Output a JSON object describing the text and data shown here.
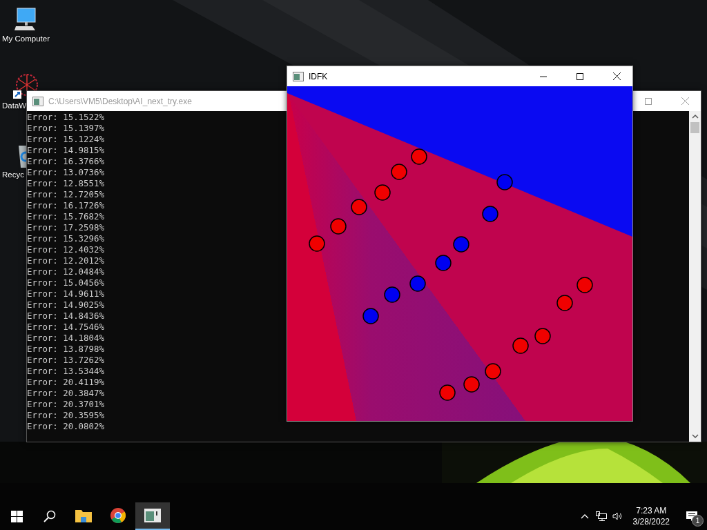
{
  "desktop_icons": [
    {
      "kind": "computer",
      "label": "My Computer"
    },
    {
      "kind": "web",
      "label": "DataW"
    },
    {
      "kind": "bin",
      "label": "Recyc"
    }
  ],
  "console_window": {
    "title": "C:\\Users\\VM5\\Desktop\\AI_next_try.exe",
    "lines": [
      "Error: 15.1522%",
      "Error: 15.1397%",
      "Error: 15.1224%",
      "Error: 14.9815%",
      "Error: 16.3766%",
      "Error: 13.0736%",
      "Error: 12.8551%",
      "Error: 12.7205%",
      "Error: 16.1726%",
      "Error: 15.7682%",
      "Error: 17.2598%",
      "Error: 15.3296%",
      "Error: 12.4032%",
      "Error: 12.2012%",
      "Error: 12.0484%",
      "Error: 15.0456%",
      "Error: 14.9611%",
      "Error: 14.9025%",
      "Error: 14.8436%",
      "Error: 14.7546%",
      "Error: 14.1804%",
      "Error: 13.8798%",
      "Error: 13.7262%",
      "Error: 13.5344%",
      "Error: 20.4119%",
      "Error: 20.3847%",
      "Error: 20.3701%",
      "Error: 20.3595%",
      "Error: 20.0802%"
    ]
  },
  "plot_window": {
    "title": "IDFK"
  },
  "taskbar": {
    "apps": [
      {
        "kind": "files",
        "selected": false
      },
      {
        "kind": "browser",
        "selected": false
      },
      {
        "kind": "console",
        "selected": true
      }
    ],
    "clock": {
      "time": "7:23 AM",
      "date": "3/28/2022"
    },
    "notification_count": "1"
  }
}
